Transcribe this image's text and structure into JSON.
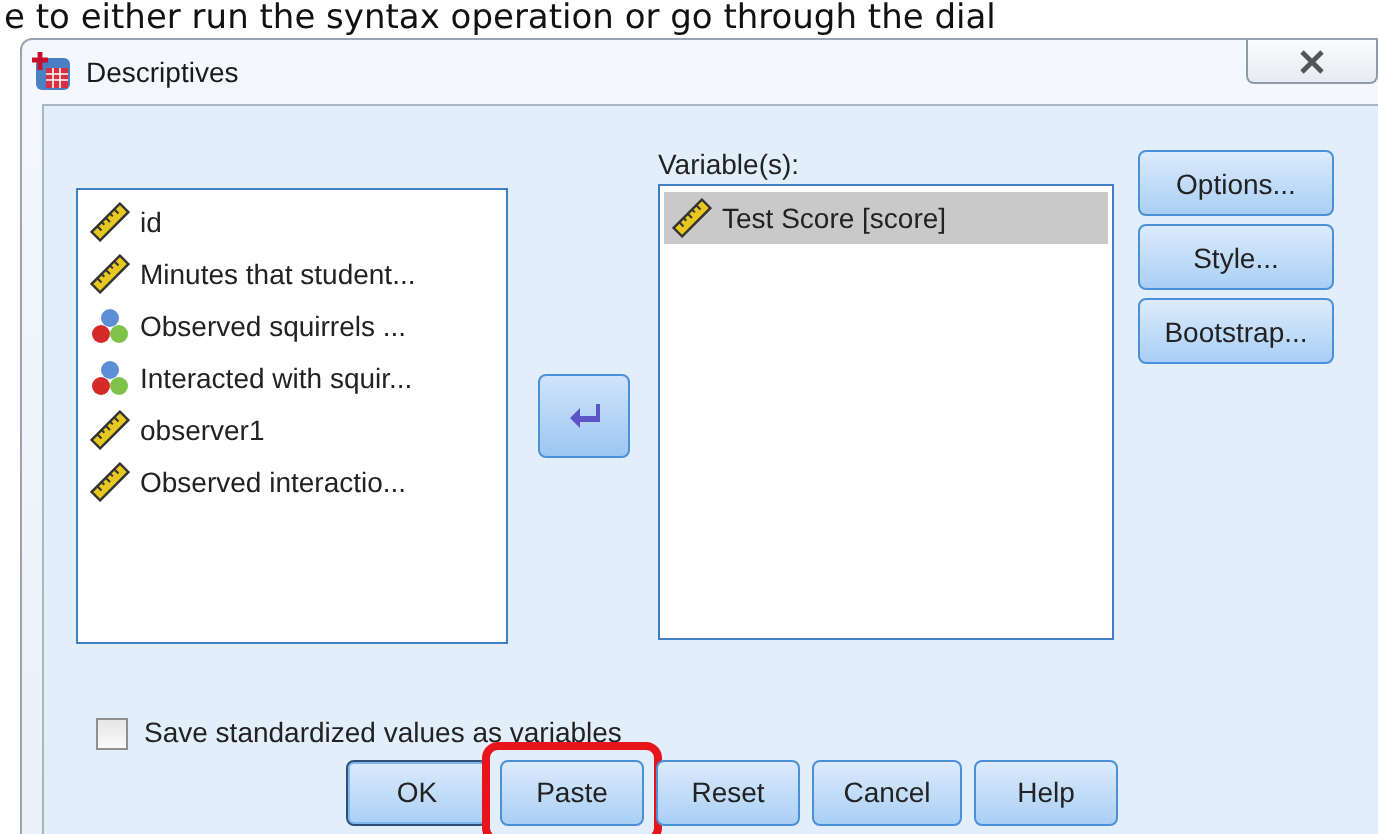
{
  "caption": "e to either run the syntax operation or go through the dial",
  "window": {
    "title": "Descriptives"
  },
  "source_list": {
    "items": [
      {
        "label": "id",
        "kind": "scale",
        "selected": false
      },
      {
        "label": "Minutes that student...",
        "kind": "scale",
        "selected": false
      },
      {
        "label": "Observed squirrels ...",
        "kind": "nominal",
        "selected": false
      },
      {
        "label": "Interacted with squir...",
        "kind": "nominal",
        "selected": false
      },
      {
        "label": "observer1",
        "kind": "scale",
        "selected": false
      },
      {
        "label": "Observed interactio...",
        "kind": "scale",
        "selected": false
      }
    ]
  },
  "target_list": {
    "label": "Variable(s):",
    "items": [
      {
        "label": "Test Score [score]",
        "kind": "scale",
        "selected": true
      }
    ]
  },
  "side_buttons": [
    "Options...",
    "Style...",
    "Bootstrap..."
  ],
  "save_checkbox": {
    "label": "Save standardized values as variables",
    "checked": false
  },
  "bottom_buttons": [
    {
      "label": "OK",
      "default": true,
      "highlighted": false
    },
    {
      "label": "Paste",
      "default": false,
      "highlighted": true
    },
    {
      "label": "Reset",
      "default": false,
      "highlighted": false
    },
    {
      "label": "Cancel",
      "default": false,
      "highlighted": false
    },
    {
      "label": "Help",
      "default": false,
      "highlighted": false
    }
  ]
}
